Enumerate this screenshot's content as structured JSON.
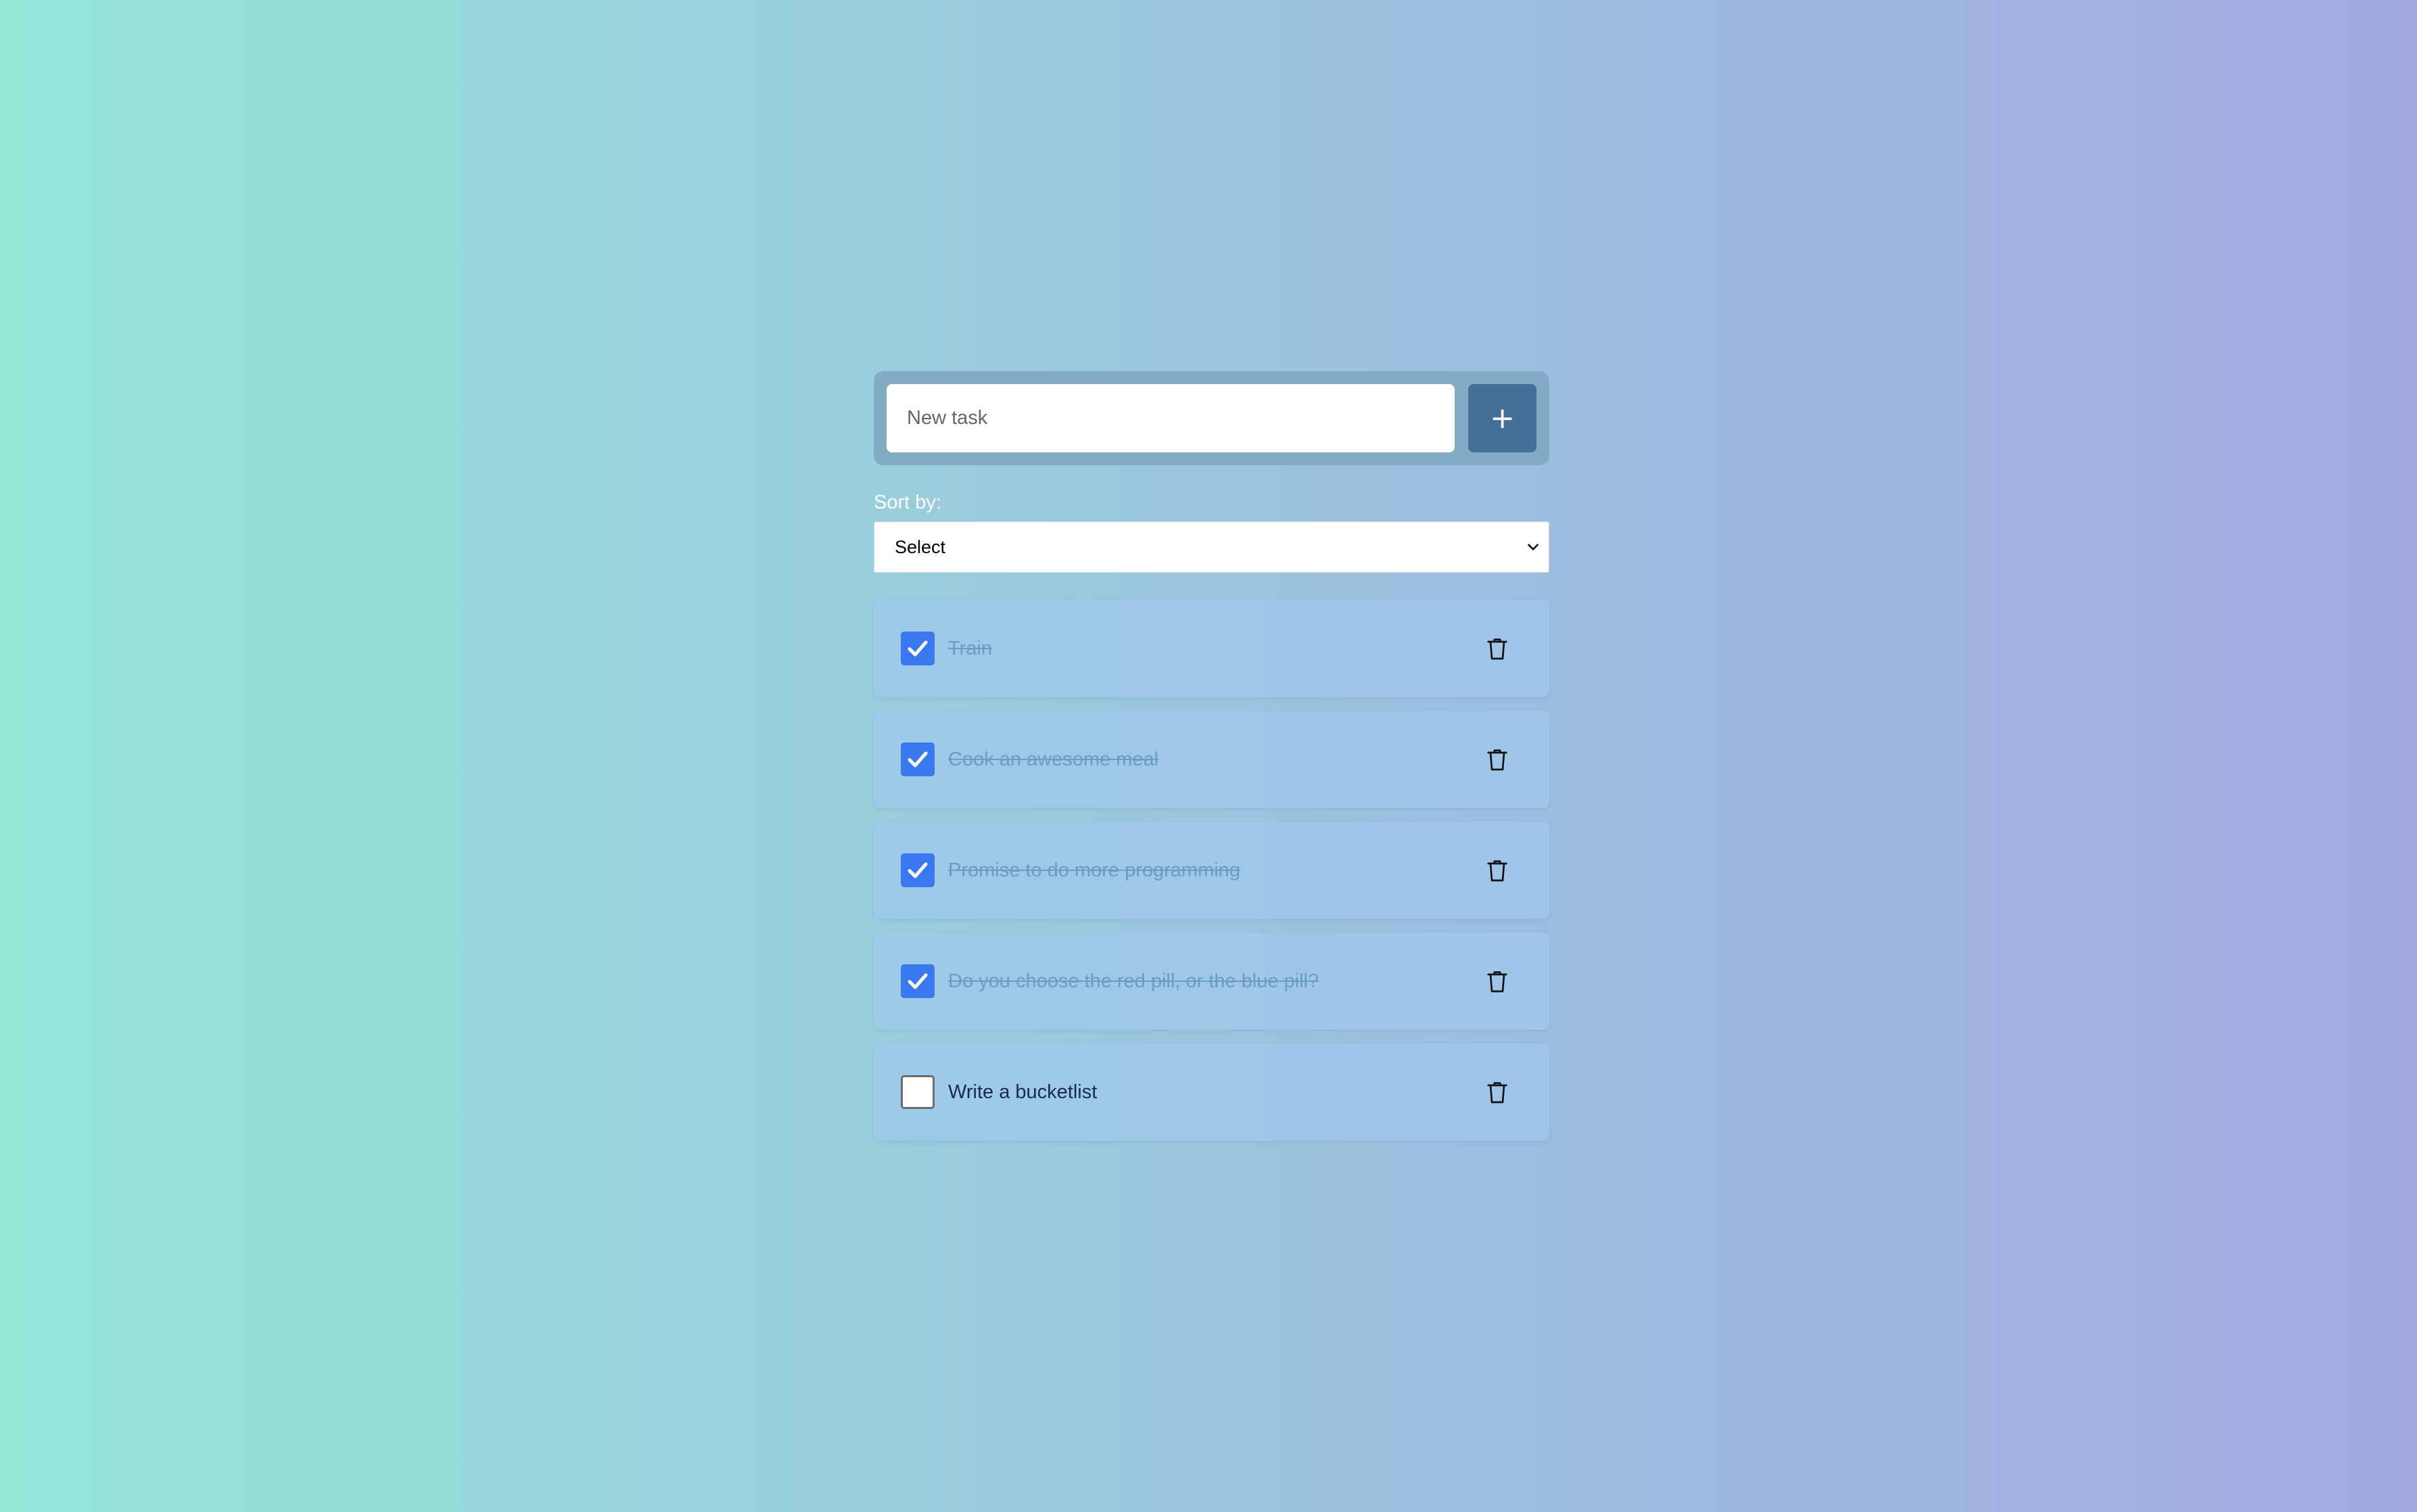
{
  "new_task": {
    "placeholder": "New task",
    "value": "",
    "add_button_label": "+"
  },
  "sort": {
    "label": "Sort by:",
    "selected": "Select"
  },
  "tasks": [
    {
      "text": "Train",
      "done": true
    },
    {
      "text": "Cook an awesome meal",
      "done": true
    },
    {
      "text": "Promise to do more programming",
      "done": true
    },
    {
      "text": "Do you choose the red pill, or the blue pill?",
      "done": true
    },
    {
      "text": "Write a bucketlist",
      "done": false
    }
  ],
  "icons": {
    "add": "plus-icon",
    "sort": "chevron-down-icon",
    "check": "checkmark-icon",
    "delete": "trash-icon"
  },
  "colors": {
    "checkbox_checked": "#3a78f0",
    "add_button": "#436f98",
    "done_text": "#6c9cc2",
    "todo_text": "#1b2a55"
  }
}
